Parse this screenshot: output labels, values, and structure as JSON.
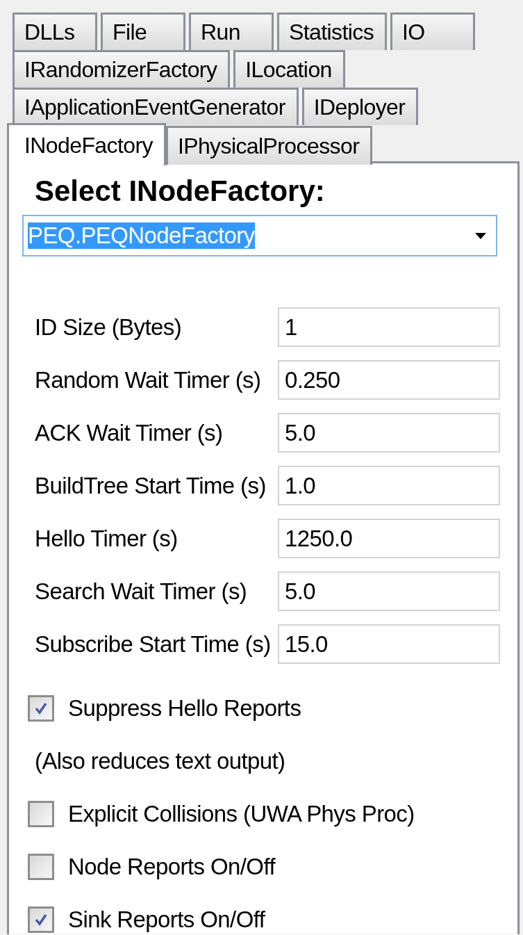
{
  "tab_rows": [
    [
      {
        "label": "DLLs",
        "selected": false
      },
      {
        "label": "File",
        "selected": false
      },
      {
        "label": "Run",
        "selected": false
      },
      {
        "label": "Statistics",
        "selected": false
      },
      {
        "label": "IO",
        "selected": false
      }
    ],
    [
      {
        "label": "IRandomizerFactory",
        "selected": false
      },
      {
        "label": "ILocation",
        "selected": false
      }
    ],
    [
      {
        "label": "IApplicationEventGenerator",
        "selected": false
      },
      {
        "label": "IDeployer",
        "selected": false
      }
    ],
    [
      {
        "label": "INodeFactory",
        "selected": true
      },
      {
        "label": "IPhysicalProcessor",
        "selected": false
      }
    ]
  ],
  "heading": "Select INodeFactory:",
  "factory_select": {
    "value": "PEQ.PEQNodeFactory"
  },
  "fields": [
    {
      "label": "ID Size (Bytes)",
      "value": "1"
    },
    {
      "label": "Random Wait Timer (s)",
      "value": "0.250"
    },
    {
      "label": "ACK Wait Timer (s)",
      "value": "5.0"
    },
    {
      "label": "BuildTree Start Time (s)",
      "value": "1.0"
    },
    {
      "label": "Hello Timer (s)",
      "value": "1250.0"
    },
    {
      "label": "Search Wait Timer (s)",
      "value": "5.0"
    },
    {
      "label": "Subscribe Start Time (s)",
      "value": "15.0"
    }
  ],
  "options": [
    {
      "kind": "checkbox",
      "label": "Suppress Hello Reports",
      "checked": true
    },
    {
      "kind": "note",
      "label": "(Also reduces text output)"
    },
    {
      "kind": "checkbox",
      "label": "Explicit Collisions (UWA Phys Proc)",
      "checked": false
    },
    {
      "kind": "checkbox",
      "label": "Node Reports On/Off",
      "checked": false
    },
    {
      "kind": "checkbox",
      "label": "Sink Reports On/Off",
      "checked": true
    }
  ]
}
